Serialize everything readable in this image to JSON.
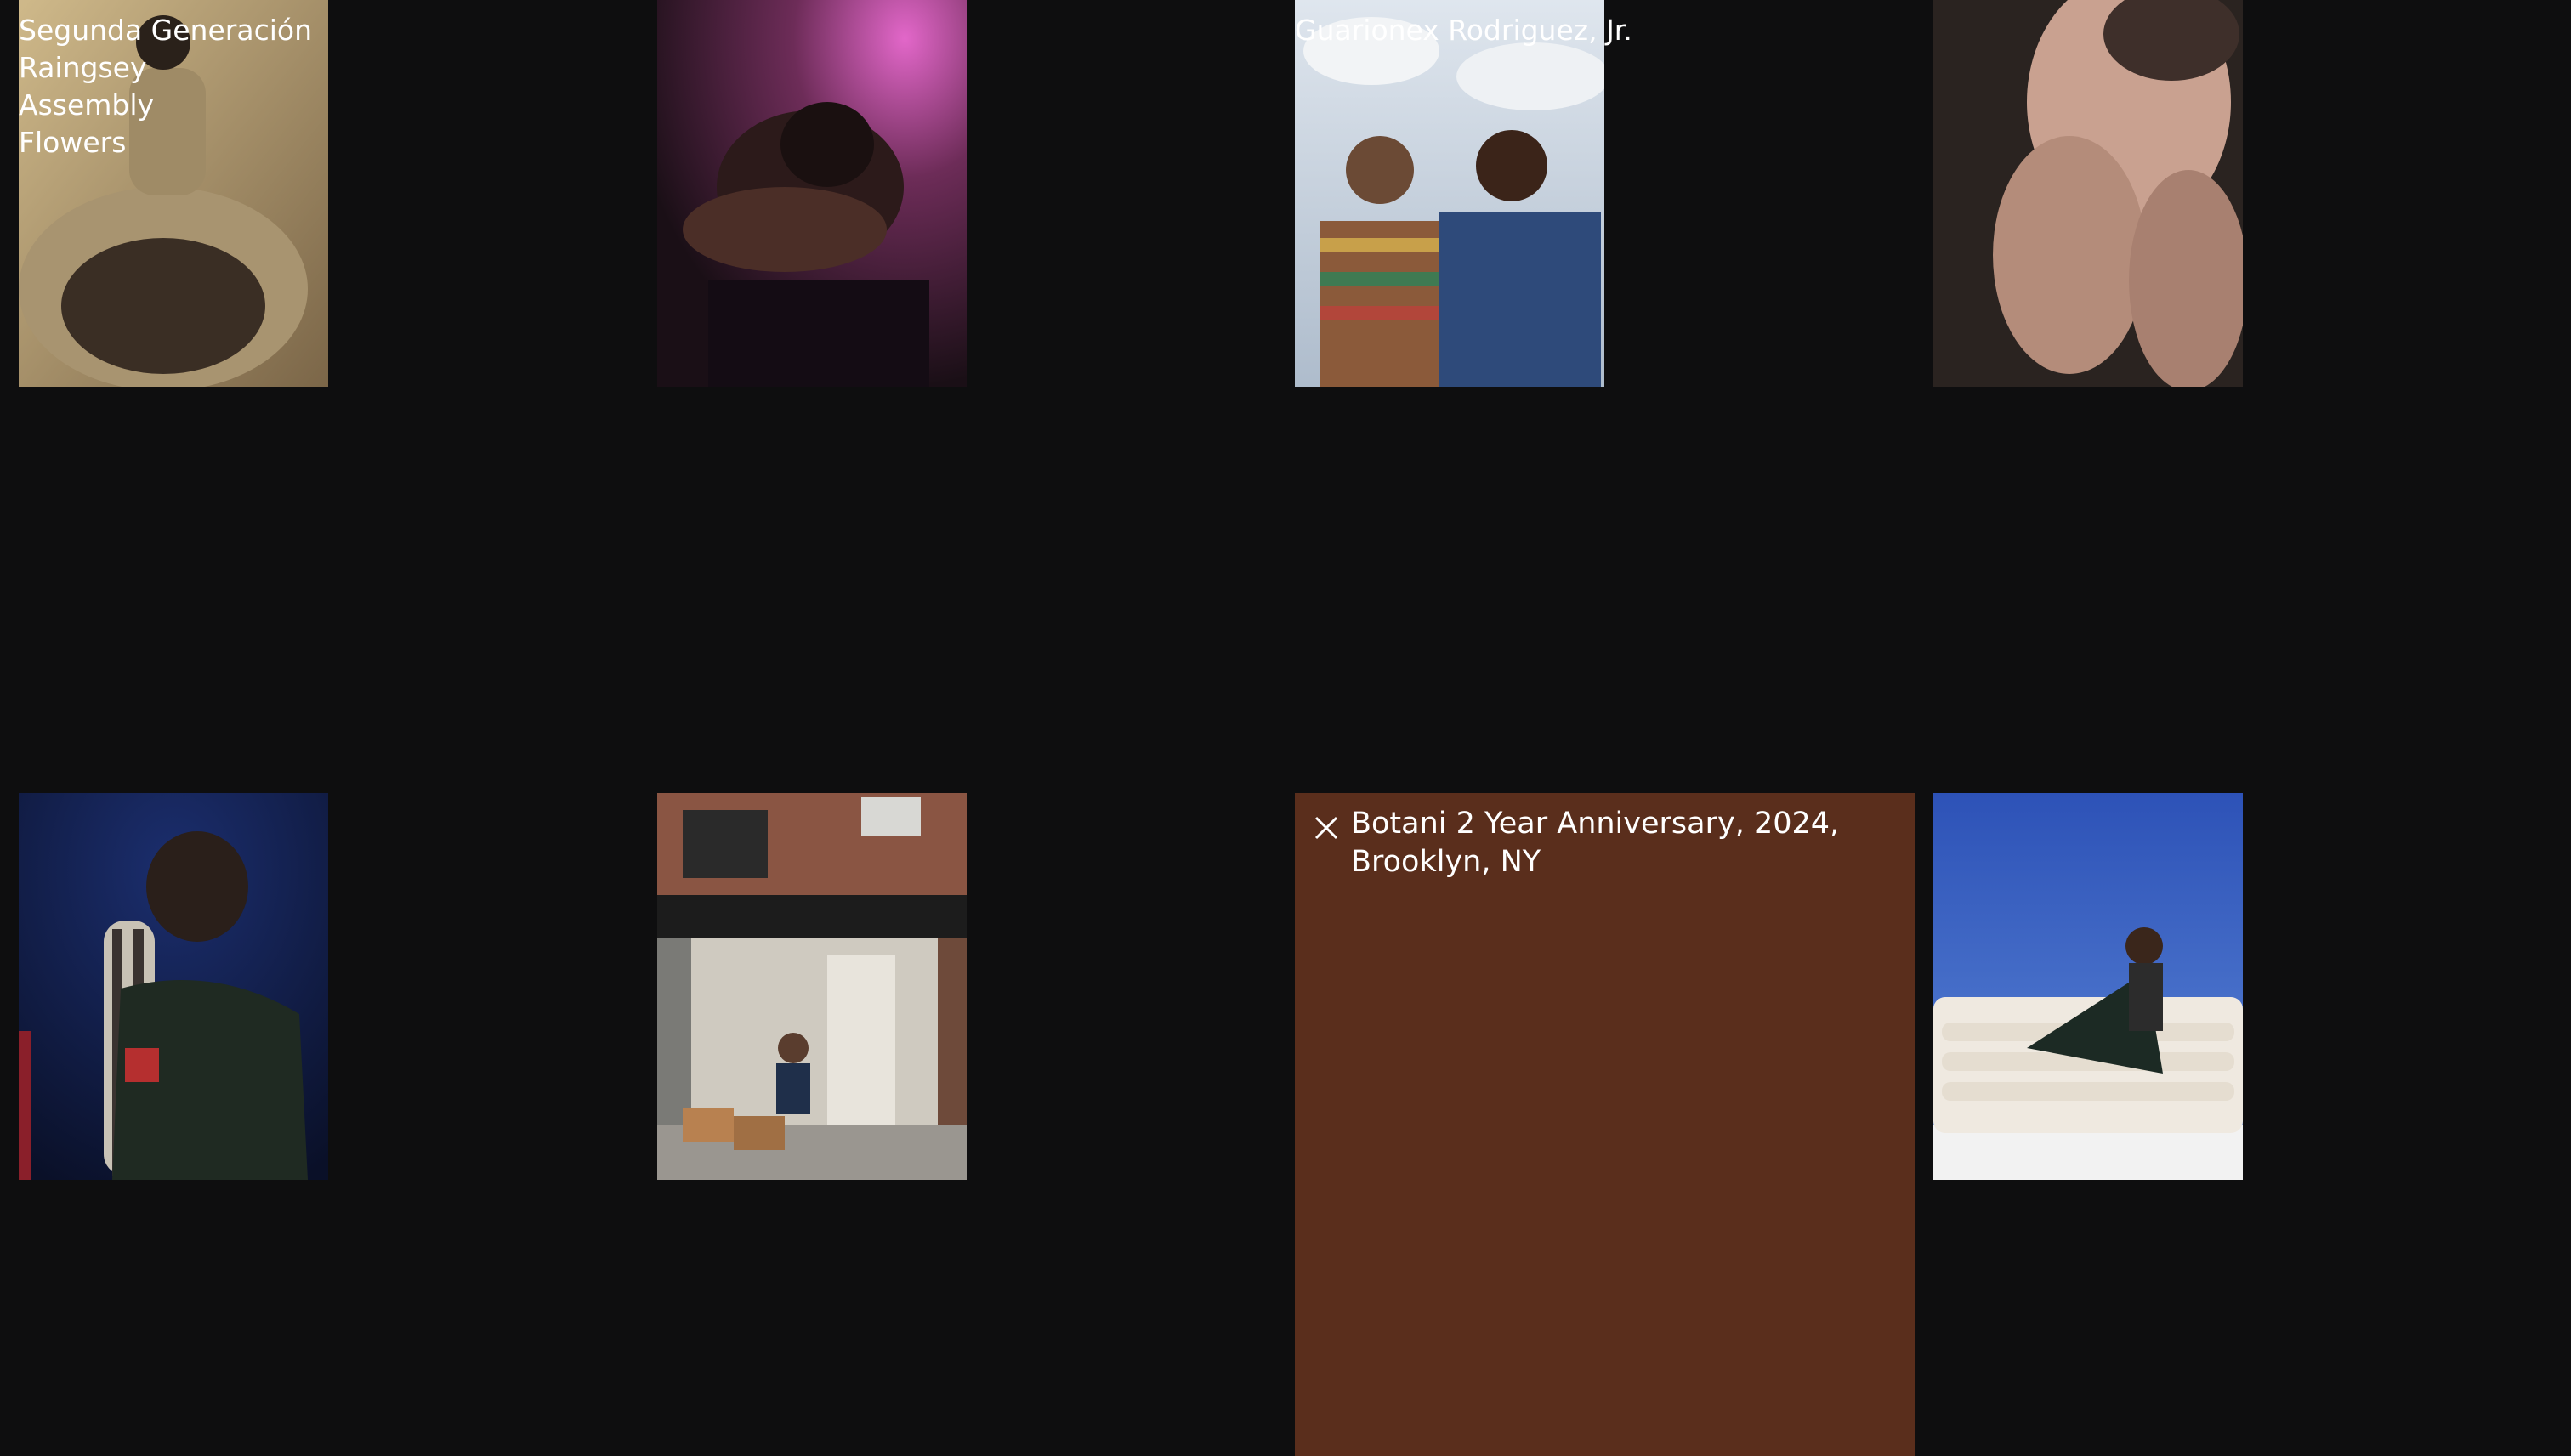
{
  "captions": {
    "left_list": [
      "Segunda Generación",
      "Raingsey",
      "Assembly",
      "Flowers"
    ],
    "middle": "Guarionex Rodriguez, Jr."
  },
  "detail": {
    "close_icon": "close-icon",
    "title_line1": "Botani 2 Year Anniversary, 2024,",
    "title_line2": "Brooklyn, NY",
    "background": "#5a2e1c"
  },
  "colors": {
    "page_background": "#0e0e0f",
    "text": "#ffffff"
  }
}
